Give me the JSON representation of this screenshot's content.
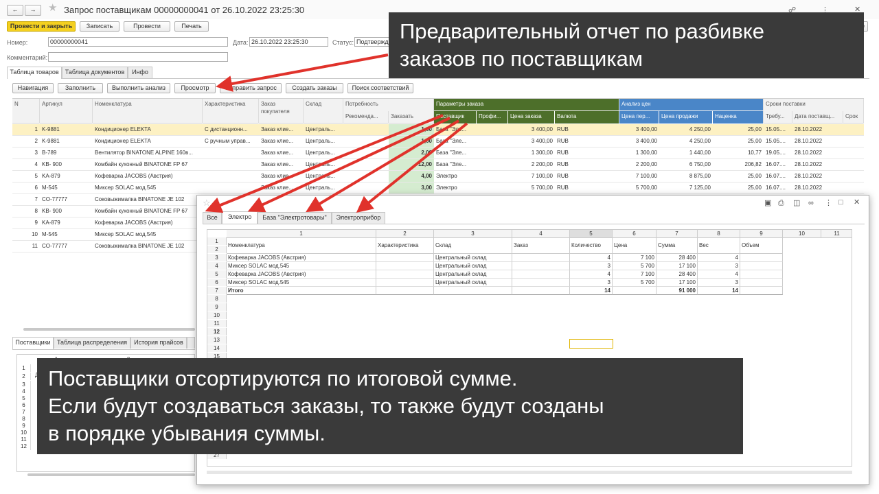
{
  "window": {
    "title": "Запрос поставщикам 00000000041 от 26.10.2022 23:25:30",
    "more": "Еще"
  },
  "toolbar": {
    "post_close": "Провести и закрыть",
    "save": "Записать",
    "post": "Провести",
    "print": "Печать"
  },
  "form": {
    "number_label": "Номер:",
    "number": "00000000041",
    "date_label": "Дата:",
    "date": "26.10.2022 23:25:30",
    "status_label": "Статус:",
    "status": "Подтвержден",
    "comment_label": "Комментарий:",
    "comment": ""
  },
  "tabs": [
    "Таблица товаров",
    "Таблица документов",
    "Инфо"
  ],
  "actions": [
    "Навигация",
    "Заполнить",
    "Выполнить анализ",
    "Просмотр",
    "Отправить запрос",
    "Создать заказы",
    "Поиск соответствий"
  ],
  "table": {
    "h": {
      "n": "N",
      "art": "Артикул",
      "nom": "Номенклатура",
      "char": "Характеристика",
      "zak": "Заказ покупателя",
      "sklad": "Склад",
      "potr": "Потребность",
      "rec": "Рекоменда...",
      "order": "Заказать",
      "params": "Параметры заказа",
      "post": "Поставщик",
      "prof": "Профи...",
      "price": "Цена заказа",
      "cur": "Валюта",
      "analysis": "Анализ цен",
      "pp": "Цена пер...",
      "ps": "Цена продажи",
      "markup": "Наценка",
      "terms": "Сроки поставки",
      "req": "Требу...",
      "dpost": "Дата поставщ...",
      "srok": "Срок"
    },
    "rows": [
      [
        "1",
        "K-9881",
        "Кондиционер ELEKTA",
        "С дистанционн...",
        "Заказ клие...",
        "Централь...",
        "1,00",
        "База \"Эле...",
        "3 400,00",
        "RUB",
        "3 400,00",
        "4 250,00",
        "25,00",
        "15.05....",
        "28.10.2022"
      ],
      [
        "2",
        "K-9881",
        "Кондиционер ELEKTA",
        "С ручным управ...",
        "Заказ клие...",
        "Централь...",
        "1,00",
        "База \"Эле...",
        "3 400,00",
        "RUB",
        "3 400,00",
        "4 250,00",
        "25,00",
        "15.05....",
        "28.10.2022"
      ],
      [
        "3",
        "B-789",
        "Вентилятор BINATONE ALPINE 160в...",
        "",
        "Заказ клие...",
        "Централь...",
        "2,00",
        "База \"Эле...",
        "1 300,00",
        "RUB",
        "1 300,00",
        "1 440,00",
        "10,77",
        "19.05....",
        "28.10.2022"
      ],
      [
        "4",
        "KB- 900",
        "Комбайн кухонный BINATONE FP 67",
        "",
        "Заказ клие...",
        "Централь...",
        "12,00",
        "База \"Эле...",
        "2 200,00",
        "RUB",
        "2 200,00",
        "6 750,00",
        "206,82",
        "16.07....",
        "28.10.2022"
      ],
      [
        "5",
        "KA-879",
        "Кофеварка JACOBS (Австрия)",
        "",
        "Заказ клие...",
        "Централь...",
        "4,00",
        "Электро",
        "7 100,00",
        "RUB",
        "7 100,00",
        "8 875,00",
        "25,00",
        "16.07....",
        "28.10.2022"
      ],
      [
        "6",
        "M-545",
        "Миксер SOLAC мод.545",
        "",
        "Заказ клие...",
        "Централь...",
        "3,00",
        "Электро",
        "5 700,00",
        "RUB",
        "5 700,00",
        "7 125,00",
        "25,00",
        "16.07....",
        "28.10.2022"
      ],
      [
        "7",
        "CO-77777",
        "Соковыжималка BINATONE JE 102",
        "",
        "",
        "",
        "",
        "",
        "",
        "",
        "",
        "",
        "",
        "",
        ""
      ],
      [
        "8",
        "KB- 900",
        "Комбайн кухонный BINATONE FP 67",
        "",
        "",
        "",
        "",
        "",
        "",
        "",
        "",
        "",
        "",
        "",
        ""
      ],
      [
        "9",
        "KA-879",
        "Кофеварка JACOBS (Австрия)",
        "",
        "",
        "",
        "",
        "",
        "",
        "",
        "",
        "",
        "",
        "",
        ""
      ],
      [
        "10",
        "M-545",
        "Миксер SOLAC мод.545",
        "",
        "",
        "",
        "",
        "",
        "",
        "",
        "",
        "",
        "",
        "",
        ""
      ],
      [
        "11",
        "CO-77777",
        "Соковыжималка BINATONE JE 102",
        "",
        "",
        "",
        "",
        "",
        "",
        "",
        "",
        "",
        "",
        "",
        ""
      ]
    ]
  },
  "bottom_tabs": [
    "Поставщики",
    "Таблица распределения",
    "История прайсов"
  ],
  "bottom": {
    "cols": [
      "1",
      "2"
    ],
    "rows": [
      "1",
      "2",
      "3",
      "4",
      "5",
      "6",
      "7",
      "8",
      "9",
      "10",
      "11",
      "12"
    ],
    "first": "Дата"
  },
  "report": {
    "tabs": [
      "Все",
      "Электро",
      "База \"Электротовары\"",
      "Электроприбор"
    ],
    "col_nums": [
      "1",
      "2",
      "3",
      "4",
      "5",
      "6",
      "7",
      "8",
      "9",
      "10",
      "11"
    ],
    "headers": [
      "Номенклатура",
      "Характеристика",
      "Склад",
      "Заказ",
      "Количество",
      "Цена",
      "Сумма",
      "Вес",
      "Объем"
    ],
    "rows": [
      [
        "Кофеварка JACOBS (Австрия)",
        "",
        "Центральный склад",
        "",
        "4",
        "7 100",
        "28 400",
        "4",
        ""
      ],
      [
        "Миксер SOLAC мод.545",
        "",
        "Центральный склад",
        "",
        "3",
        "5 700",
        "17 100",
        "3",
        ""
      ],
      [
        "Кофеварка JACOBS (Австрия)",
        "",
        "Центральный склад",
        "",
        "4",
        "7 100",
        "28 400",
        "4",
        ""
      ],
      [
        "Миксер SOLAC мод.545",
        "",
        "Центральный склад",
        "",
        "3",
        "5 700",
        "17 100",
        "3",
        ""
      ]
    ],
    "total": [
      "Итого",
      "",
      "",
      "",
      "14",
      "",
      "91 000",
      "14",
      ""
    ],
    "row_nums": [
      "1",
      "2",
      "3",
      "4",
      "5",
      "6",
      "7",
      "8",
      "9",
      "10",
      "11",
      "12",
      "13",
      "14",
      "15",
      "16",
      "17",
      "18",
      "19",
      "20",
      "21",
      "22",
      "23",
      "24",
      "25",
      "26",
      "27"
    ]
  },
  "callout_top": [
    "Предварительный отчет по разбивке",
    "заказов по поставщикам"
  ],
  "callout_bottom": [
    "Поставщики отсортируются по итоговой сумме.",
    "Если будут создаваться заказы, то также будут созданы",
    "в порядке убывания суммы."
  ],
  "colors": {
    "primary_btn": "#f4d020",
    "group_green": "#4d6f2a",
    "group_blue": "#4a86c8",
    "arrow": "#e0322b",
    "callout": "#3a3a3a"
  }
}
